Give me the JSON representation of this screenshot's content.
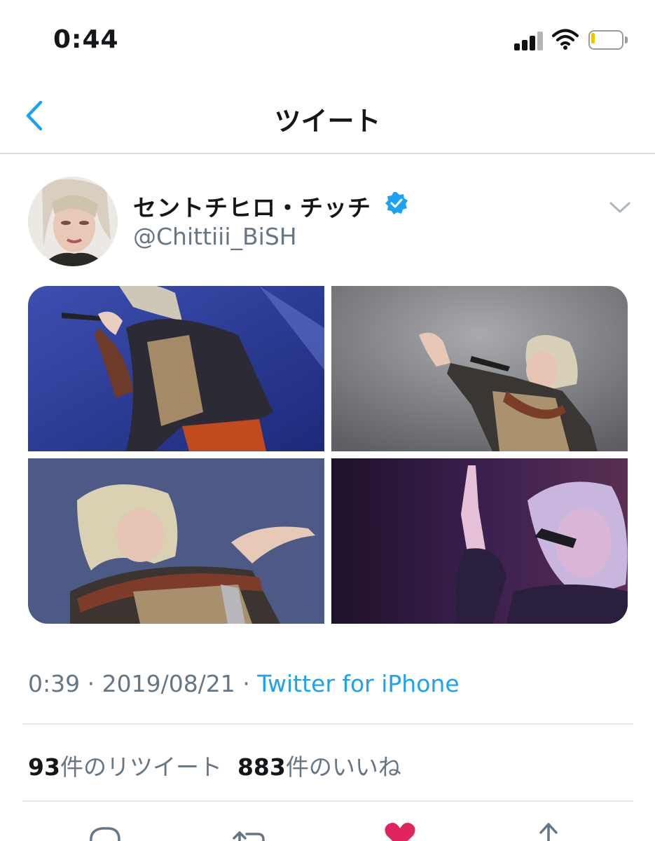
{
  "status_bar": {
    "time": "0:44",
    "signal_icon": "cellular-signal-icon",
    "wifi_icon": "wifi-icon",
    "battery_icon": "battery-low-icon",
    "battery_level": 0.12,
    "battery_color": "#f0c400"
  },
  "nav": {
    "back_icon": "chevron-left-icon",
    "title": "ツイート",
    "accent_color": "#1da1f2"
  },
  "tweet": {
    "author": {
      "display_name": "セントチヒロ・チッチ",
      "username": "@Chittiii_BiSH",
      "verified_icon": "verified-badge-icon",
      "avatar": "avatar-photo"
    },
    "menu_icon": "chevron-down-icon",
    "media": [
      {
        "name": "photo-performer-blue-stage"
      },
      {
        "name": "photo-performer-grey-stage"
      },
      {
        "name": "photo-performer-blue-closeup"
      },
      {
        "name": "photo-performer-purple-stage"
      }
    ],
    "time": "0:39",
    "separator": " · ",
    "date": "2019/08/21",
    "source": "Twitter for iPhone",
    "retweets": {
      "count": "93",
      "label": "件のリツイート"
    },
    "likes": {
      "count": "883",
      "label": "件のいいね"
    }
  },
  "actions": [
    {
      "name": "reply-icon"
    },
    {
      "name": "retweet-icon"
    },
    {
      "name": "like-icon",
      "active_color": "#e0245e"
    },
    {
      "name": "share-icon"
    }
  ]
}
